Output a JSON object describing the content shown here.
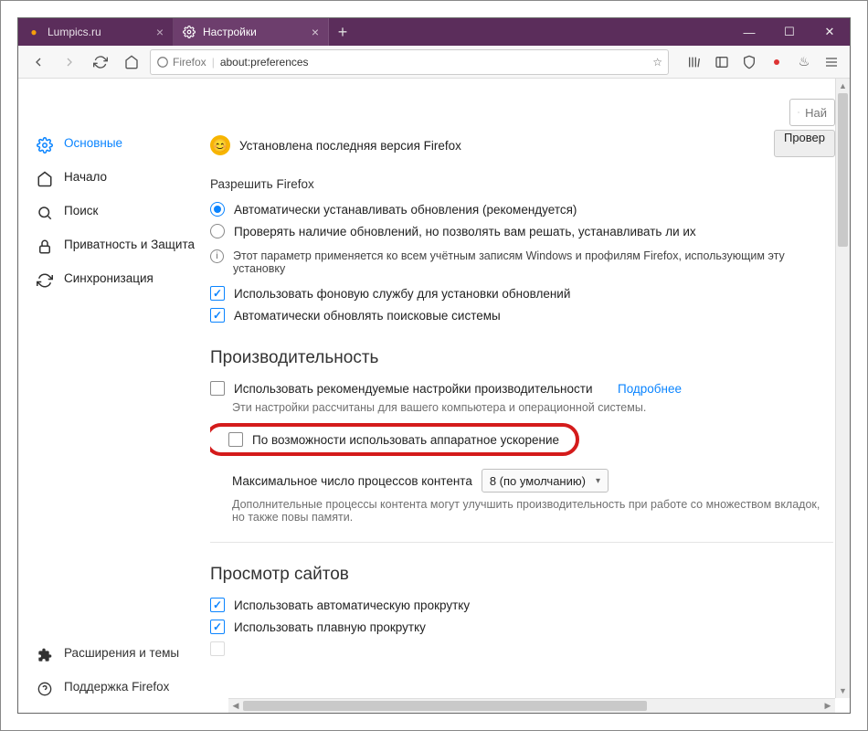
{
  "window": {
    "tabs": [
      {
        "title": "Lumpics.ru",
        "favicon": "L",
        "favicon_color": "#f59e0b"
      },
      {
        "title": "Настройки",
        "favicon": "gear"
      }
    ],
    "newtab": "+",
    "controls": {
      "min": "—",
      "max": "☐",
      "close": "✕"
    }
  },
  "toolbar": {
    "identity_label": "Firefox",
    "url": "about:preferences"
  },
  "leftnav": {
    "items": [
      {
        "id": "general",
        "label": "Основные",
        "icon": "gear"
      },
      {
        "id": "home",
        "label": "Начало",
        "icon": "home"
      },
      {
        "id": "search",
        "label": "Поиск",
        "icon": "search"
      },
      {
        "id": "privacy",
        "label": "Приватность и Защита",
        "icon": "lock"
      },
      {
        "id": "sync",
        "label": "Синхронизация",
        "icon": "sync"
      }
    ],
    "bottom": [
      {
        "id": "addons",
        "label": "Расширения и темы",
        "icon": "puzzle"
      },
      {
        "id": "support",
        "label": "Поддержка Firefox",
        "icon": "help"
      }
    ]
  },
  "search": {
    "placeholder": "Най"
  },
  "updates": {
    "installed_latest": "Установлена последняя версия Firefox",
    "check_button": "Провер",
    "allow_title": "Разрешить Firefox",
    "radio_auto": "Автоматически устанавливать обновления (рекомендуется)",
    "radio_check": "Проверять наличие обновлений, но позволять вам решать, устанавливать ли их",
    "info_note": "Этот параметр применяется ко всем учётным записям Windows и профилям Firefox, использующим эту установку",
    "cb_service": "Использовать фоновую службу для установки обновлений",
    "cb_search_engines": "Автоматически обновлять поисковые системы"
  },
  "performance": {
    "title": "Производительность",
    "cb_recommended": "Использовать рекомендуемые настройки производительности",
    "learn_more": "Подробнее",
    "hint1": "Эти настройки рассчитаны для вашего компьютера и операционной системы.",
    "cb_hw_accel": "По возможности использовать аппаратное ускорение",
    "procs_label": "Максимальное число процессов контента",
    "procs_value": "8 (по умолчанию)",
    "hint2": "Дополнительные процессы контента могут улучшить производительность при работе со множеством вкладок, но также повы памяти."
  },
  "browsing": {
    "title": "Просмотр сайтов",
    "cb_autoscroll": "Использовать автоматическую прокрутку",
    "cb_smoothscroll": "Использовать плавную прокрутку"
  }
}
